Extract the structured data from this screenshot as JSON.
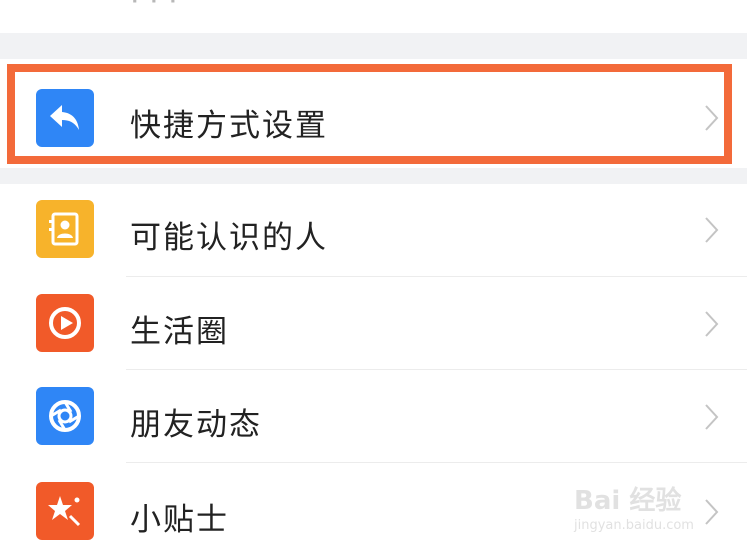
{
  "top_partial_text": "· · ·",
  "settings": [
    {
      "label": "快捷方式设置",
      "icon": "reply-arrow-icon",
      "color": "#2f86f6",
      "highlighted": true
    },
    {
      "label": "可能认识的人",
      "icon": "contact-card-icon",
      "color": "#f7b32b",
      "highlighted": false
    },
    {
      "label": "生活圈",
      "icon": "play-ring-icon",
      "color": "#f15a29",
      "highlighted": false
    },
    {
      "label": "朋友动态",
      "icon": "aperture-icon",
      "color": "#2f86f6",
      "highlighted": false
    },
    {
      "label": "小贴士",
      "icon": "star-sparkle-icon",
      "color": "#f15a29",
      "highlighted": false
    }
  ],
  "highlight_color": "#f36a3a",
  "watermark": {
    "main": "Bai 经验",
    "sub": "jingyan.baidu.com"
  }
}
